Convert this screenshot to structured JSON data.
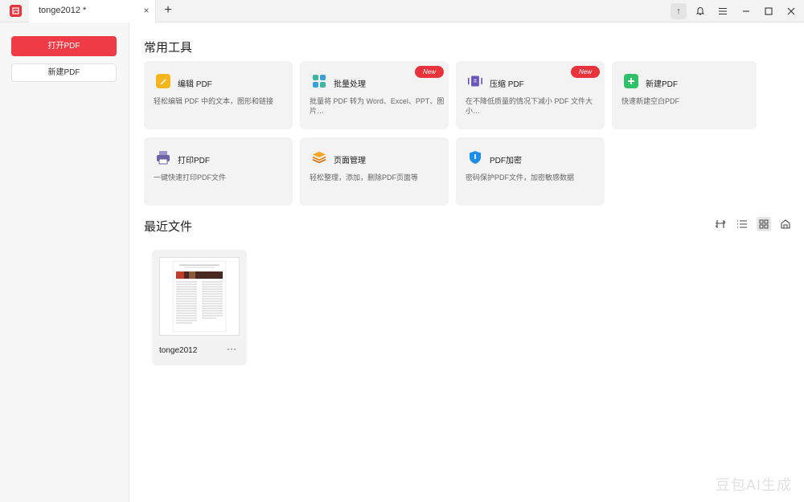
{
  "titlebar": {
    "tab_title": "tonge2012 *",
    "tab_close": "×",
    "new_tab": "+",
    "upload": "↑"
  },
  "sidebar": {
    "open_pdf": "打开PDF",
    "new_pdf": "新建PDF"
  },
  "tools": {
    "title": "常用工具",
    "items": [
      {
        "name": "编辑 PDF",
        "desc": "轻松编辑 PDF 中的文本，图形和链接",
        "icon": "edit-icon",
        "color": "#f5b51c",
        "badge": ""
      },
      {
        "name": "批量处理",
        "desc": "批量将 PDF 转为 Word、Excel、PPT、图片…",
        "icon": "batch-icon",
        "color": "#3fb6a0",
        "badge": "New"
      },
      {
        "name": "压缩 PDF",
        "desc": "在不降低质量的情况下减小 PDF 文件大小…",
        "icon": "compress-icon",
        "color": "#6a57b8",
        "badge": "New"
      },
      {
        "name": "新建PDF",
        "desc": "快速新建空白PDF",
        "icon": "plus-icon",
        "color": "#2ec167",
        "badge": ""
      },
      {
        "name": "打印PDF",
        "desc": "一键快速打印PDF文件",
        "icon": "printer-icon",
        "color": "#6b62a8",
        "badge": ""
      },
      {
        "name": "页面管理",
        "desc": "轻松整理，添加，删除PDF页面等",
        "icon": "layers-icon",
        "color": "#f08a24",
        "badge": ""
      },
      {
        "name": "PDF加密",
        "desc": "密码保护PDF文件，加密敏感数据",
        "icon": "shield-icon",
        "color": "#1e8de8",
        "badge": ""
      }
    ]
  },
  "recent": {
    "title": "最近文件",
    "files": [
      {
        "name": "tonge2012",
        "more": "···"
      }
    ]
  },
  "watermark": "豆包AI生成"
}
